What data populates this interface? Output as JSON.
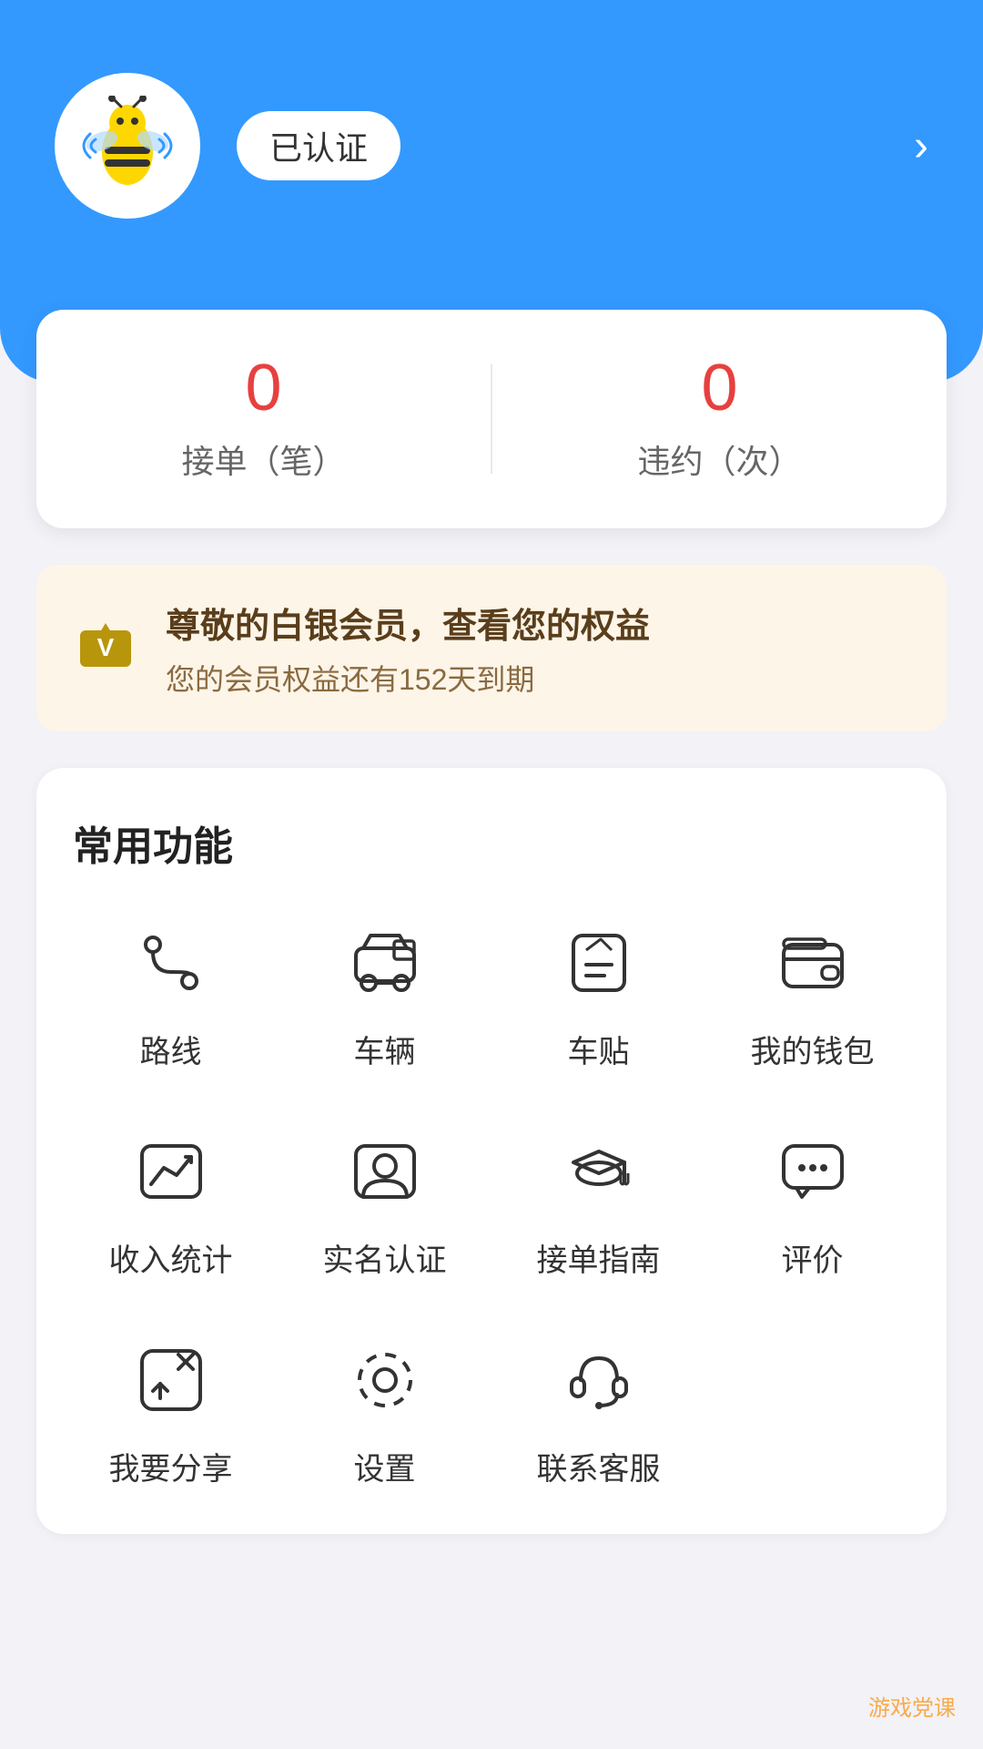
{
  "header": {
    "certified_label": "已认证",
    "chevron": "›"
  },
  "stats": {
    "orders_count": "0",
    "orders_label": "接单（笔）",
    "violations_count": "0",
    "violations_label": "违约（次）"
  },
  "member": {
    "title": "尊敬的白银会员，查看您的权益",
    "subtitle": "您的会员权益还有152天到期"
  },
  "functions": {
    "section_title": "常用功能",
    "items_row1": [
      {
        "id": "route",
        "label": "路线"
      },
      {
        "id": "vehicle",
        "label": "车辆"
      },
      {
        "id": "car-sticker",
        "label": "车贴"
      },
      {
        "id": "wallet",
        "label": "我的钱包"
      }
    ],
    "items_row2": [
      {
        "id": "income-stats",
        "label": "收入统计"
      },
      {
        "id": "real-name",
        "label": "实名认证"
      },
      {
        "id": "order-guide",
        "label": "接单指南"
      },
      {
        "id": "review",
        "label": "评价"
      }
    ],
    "items_row3": [
      {
        "id": "share",
        "label": "我要分享"
      },
      {
        "id": "settings",
        "label": "设置"
      },
      {
        "id": "customer-service",
        "label": "联系客服"
      }
    ]
  },
  "watermark": "游戏党课"
}
